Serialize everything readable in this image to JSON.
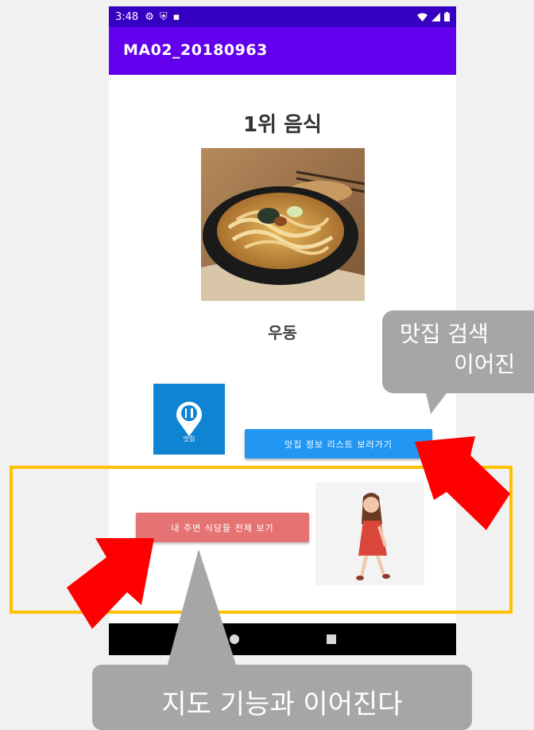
{
  "status_bar": {
    "time": "3:48"
  },
  "app_bar": {
    "title": "MA02_20180963"
  },
  "main": {
    "heading": "1위 음식",
    "food_name": "우동",
    "map_tile_label": "맛집",
    "list_button_label": "맛집 정보 리스트 보러가기",
    "nearby_button_label": "내 주변 식당들 전체 보기"
  },
  "annotations": {
    "callout_right_line1": "맛집 검색",
    "callout_right_line2": "이어진",
    "callout_bottom": "지도 기능과 이어진다"
  },
  "colors": {
    "status_bar": "#3600c2",
    "app_bar": "#6200ee",
    "list_button": "#2196f3",
    "nearby_button": "#e57373",
    "map_tile": "#0e84d3",
    "highlight": "#ffc000",
    "arrow": "#ff0000",
    "callout": "#a6a6a6"
  },
  "icons": [
    "gear-icon",
    "shield-icon",
    "sd-card-icon",
    "wifi-icon",
    "signal-icon",
    "battery-icon",
    "map-pin-icon",
    "home-nav-icon",
    "recents-nav-icon"
  ]
}
